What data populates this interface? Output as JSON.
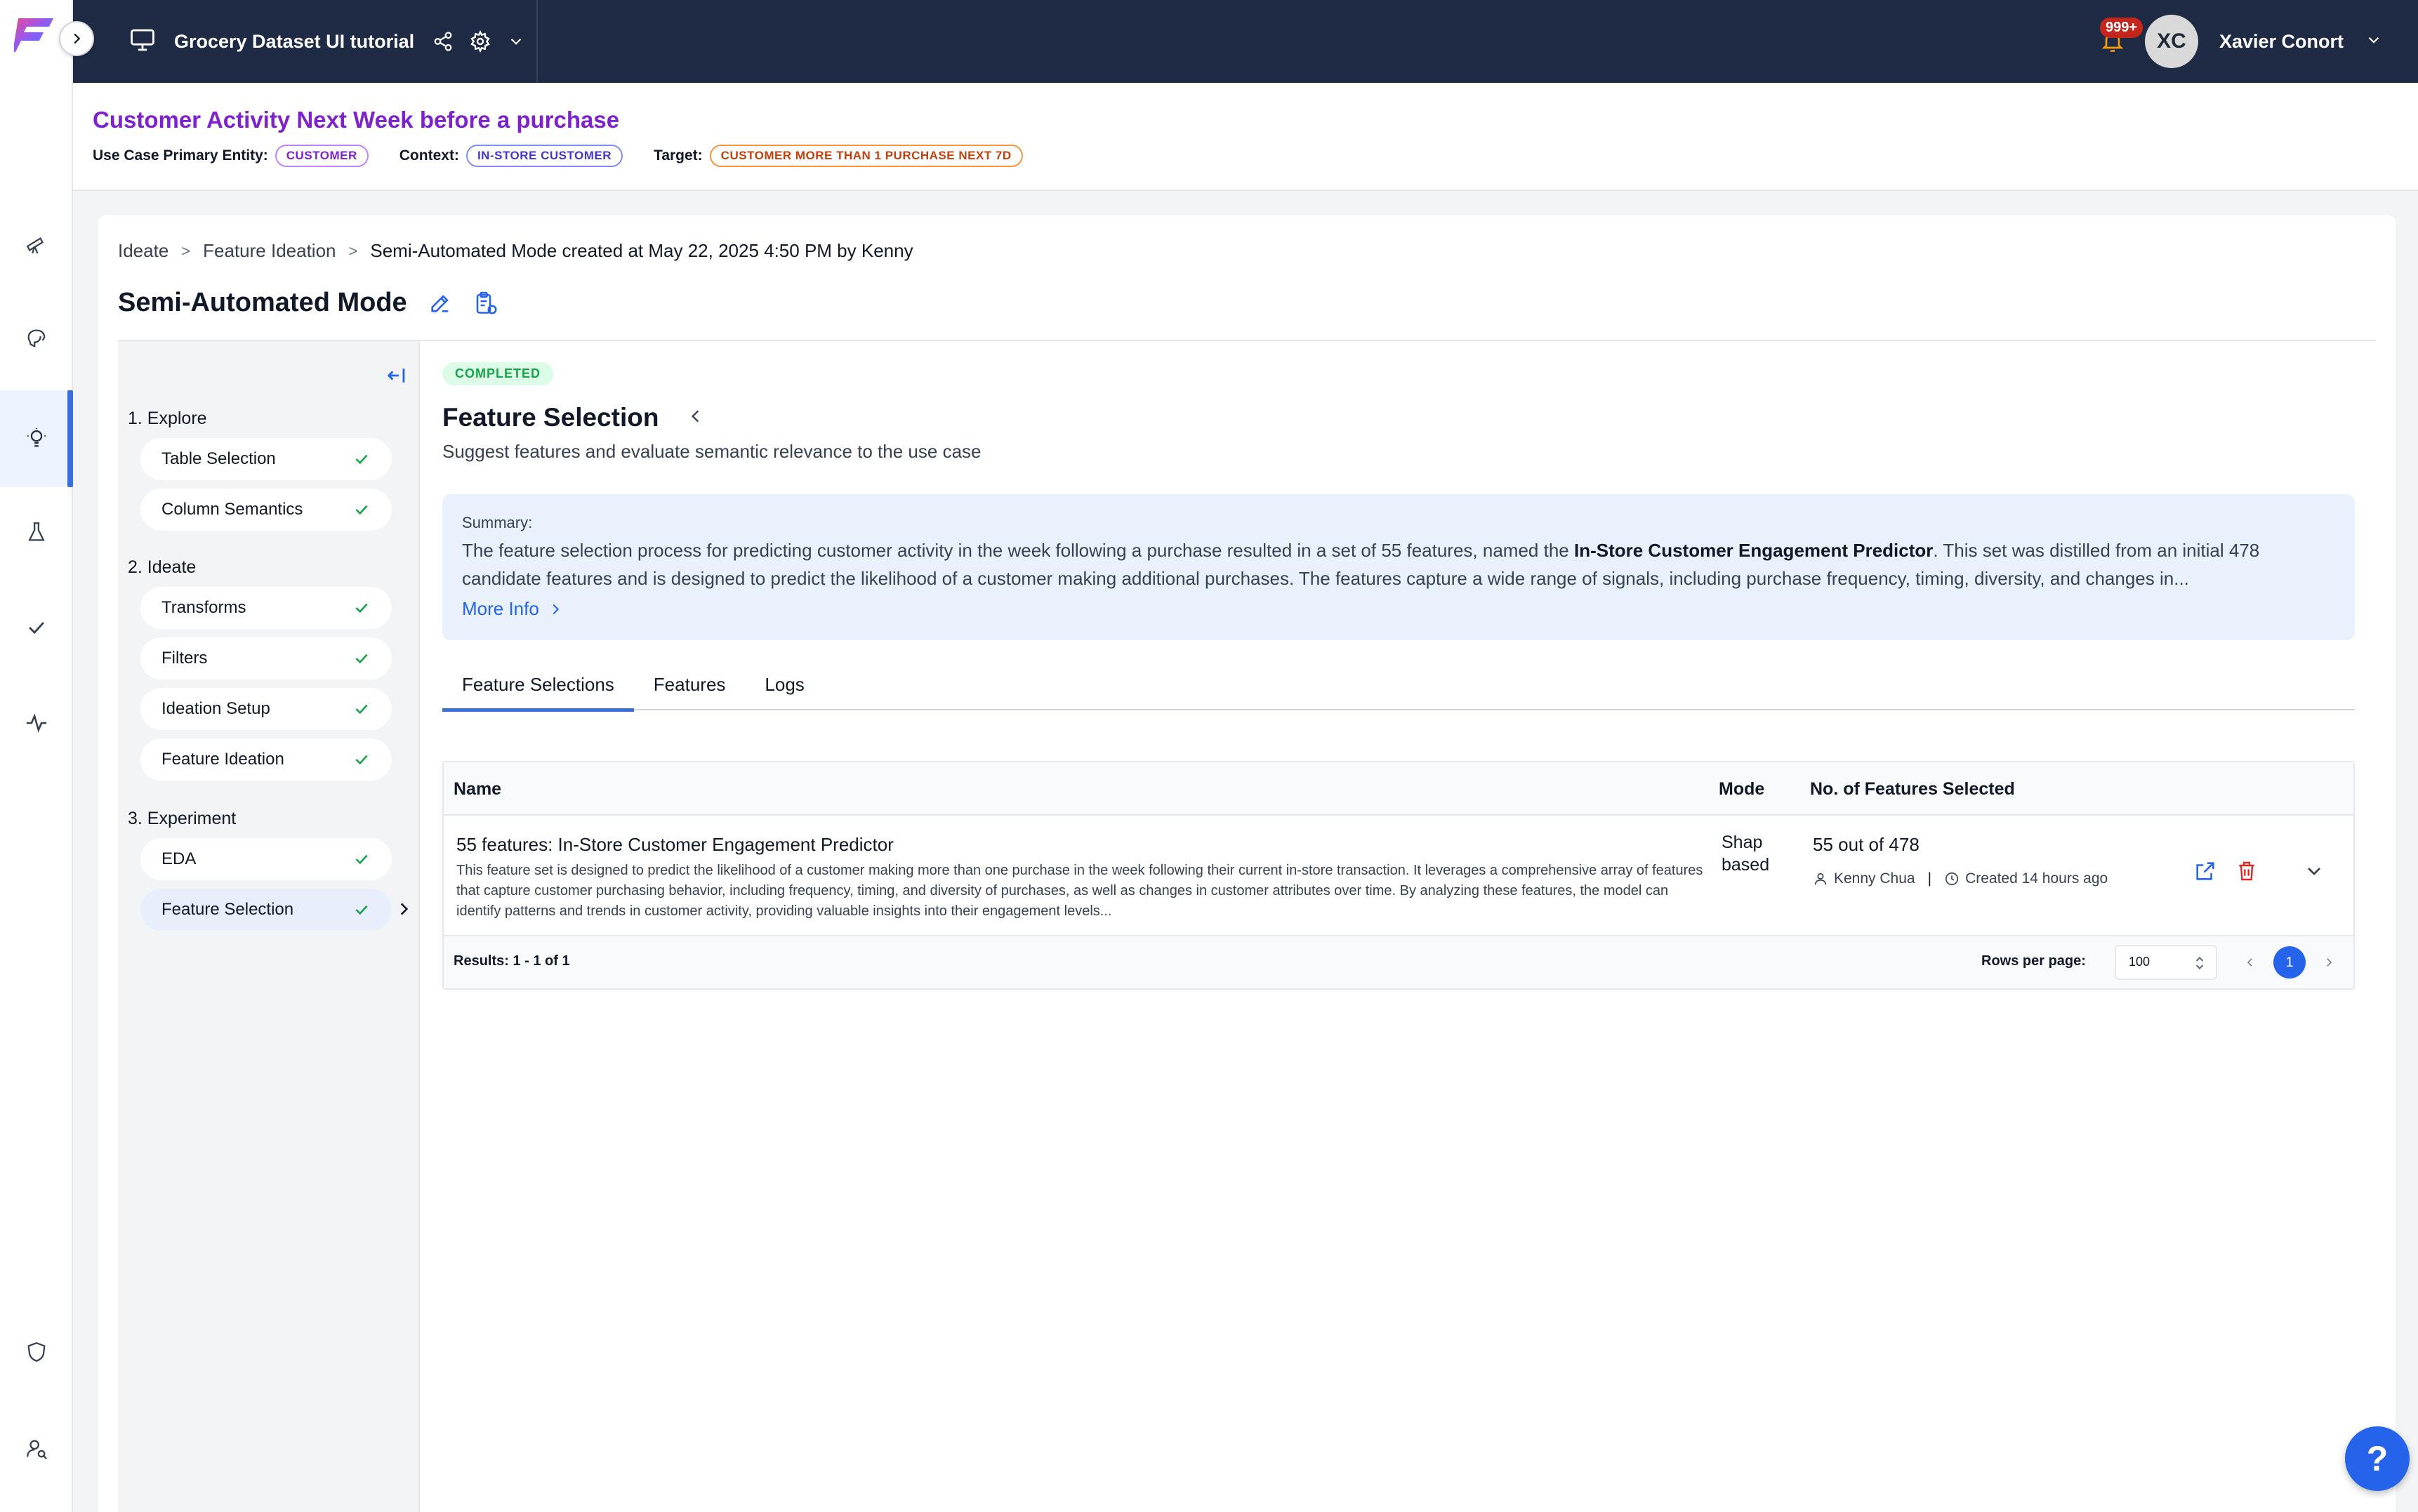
{
  "app": {
    "project_title": "Grocery Dataset UI tutorial",
    "notifications_count": "999+",
    "user_initials": "XC",
    "user_name": "Xavier Conort"
  },
  "use_case": {
    "title": "Customer Activity Next Week before a purchase",
    "primary_entity_label": "Use Case Primary Entity:",
    "primary_entity": "CUSTOMER",
    "context_label": "Context:",
    "context": "IN-STORE CUSTOMER",
    "target_label": "Target:",
    "target": "CUSTOMER MORE THAN 1 PURCHASE NEXT 7D"
  },
  "breadcrumb": [
    "Ideate",
    "Feature Ideation",
    "Semi-Automated Mode created at May 22, 2025 4:50 PM by Kenny"
  ],
  "mode_title": "Semi-Automated Mode",
  "steps": {
    "sections": [
      {
        "label": "1. Explore",
        "items": [
          "Table Selection",
          "Column Semantics"
        ]
      },
      {
        "label": "2. Ideate",
        "items": [
          "Transforms",
          "Filters",
          "Ideation Setup",
          "Feature Ideation"
        ]
      },
      {
        "label": "3. Experiment",
        "items": [
          "EDA",
          "Feature Selection"
        ]
      }
    ]
  },
  "content": {
    "status": "COMPLETED",
    "title": "Feature Selection",
    "subtitle": "Suggest features and evaluate semantic relevance to the use case",
    "summary_label": "Summary:",
    "summary_text_1": "The feature selection process for predicting customer activity in the week following a purchase resulted in a set of 55 features, named the ",
    "summary_bold": "In-Store Customer Engagement Predictor",
    "summary_text_2": ". This set was distilled from an initial 478 candidate features and is designed to predict the likelihood of a customer making additional purchases. The features capture a wide range of signals, including purchase frequency, timing, diversity, and changes in...",
    "more_info": "More Info",
    "tabs": [
      "Feature Selections",
      "Features",
      "Logs"
    ]
  },
  "table": {
    "headers": {
      "name": "Name",
      "mode": "Mode",
      "count": "No. of Features Selected"
    },
    "row": {
      "name": "55 features: In-Store Customer Engagement Predictor",
      "description": "This feature set is designed to predict the likelihood of a customer making more than one purchase in the week following their current in-store transaction. It leverages a comprehensive array of features that capture customer purchasing behavior, including frequency, timing, and diversity of purchases, as well as changes in customer attributes over time. By analyzing these features, the model can identify patterns and trends in customer activity, providing valuable insights into their engagement levels...",
      "mode_line1": "Shap",
      "mode_line2": "based",
      "count": "55 out of 478",
      "author": "Kenny Chua",
      "created": "Created 14 hours ago"
    },
    "footer": {
      "results": "Results: 1 - 1 of 1",
      "rows_per_page_label": "Rows per page:",
      "rows_per_page": "100",
      "page": "1"
    }
  },
  "help": "?",
  "colors": {
    "accent": "#3b6fd8",
    "topbar": "#1f2a44",
    "title_purple": "#7e22ce",
    "success": "#16a34a",
    "danger": "#dc2626"
  }
}
